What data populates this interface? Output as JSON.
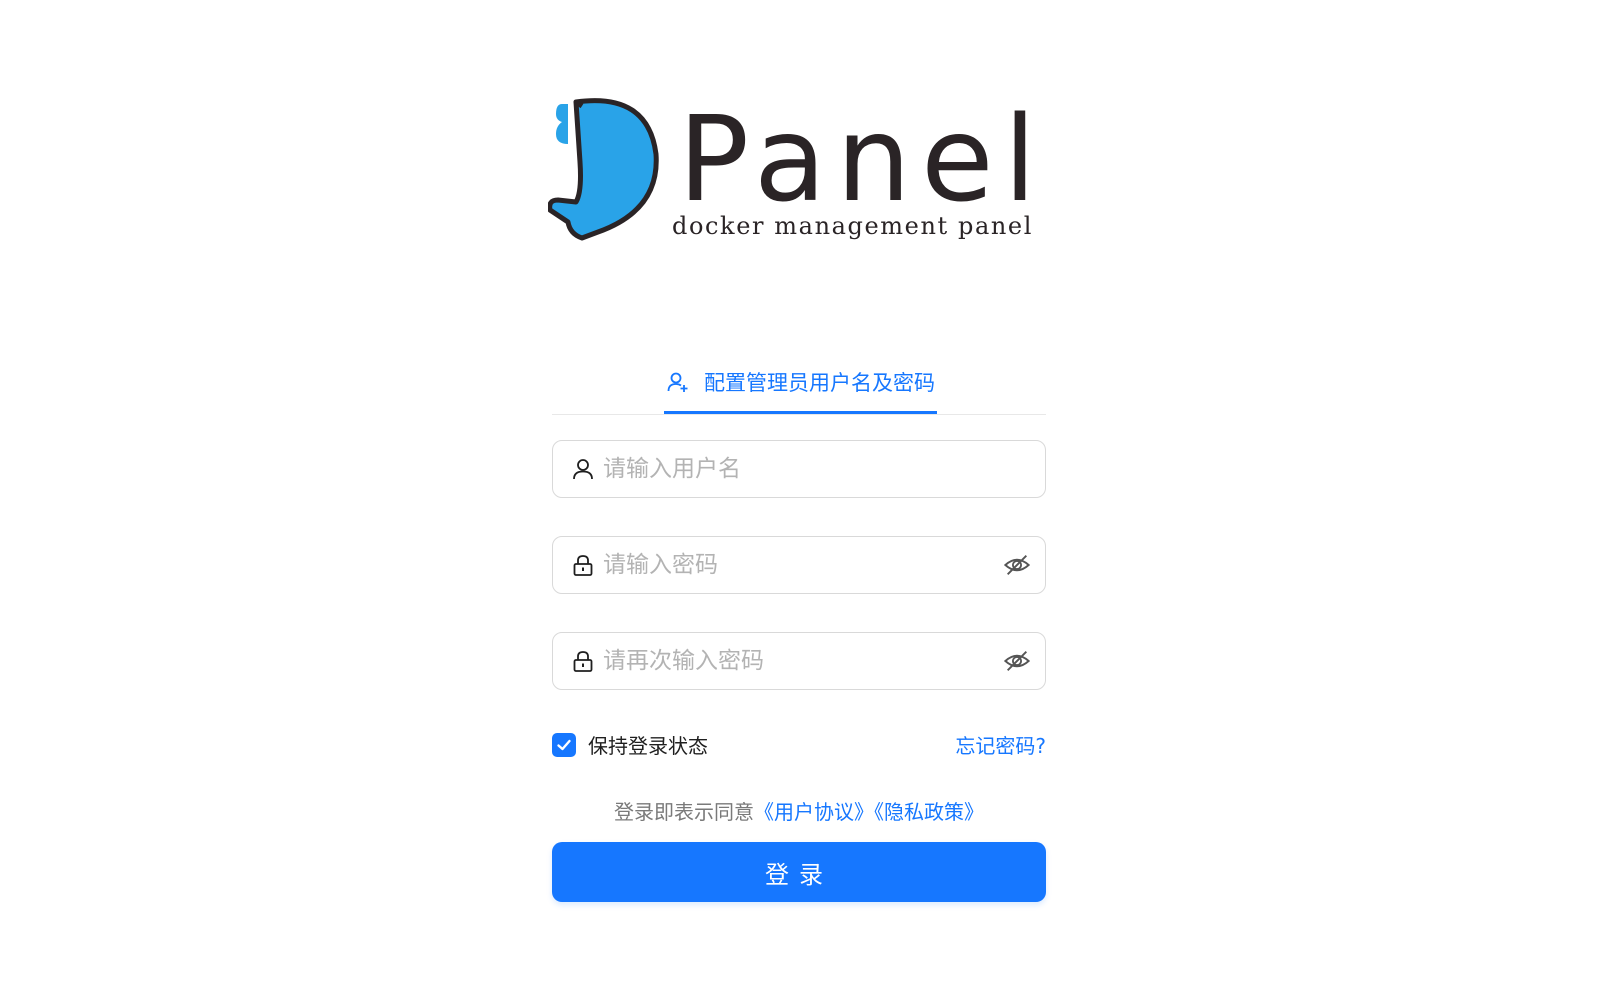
{
  "logo": {
    "title": "Panel",
    "subtitle": "docker management panel"
  },
  "tab": {
    "label": "配置管理员用户名及密码"
  },
  "username": {
    "placeholder": "请输入用户名"
  },
  "password": {
    "placeholder": "请输入密码"
  },
  "confirm": {
    "placeholder": "请再次输入密码"
  },
  "remember": {
    "label": "保持登录状态",
    "checked": true
  },
  "forgot": {
    "label": "忘记密码?"
  },
  "agreement": {
    "prefix": "登录即表示同意",
    "terms": "《用户协议》",
    "privacy": "《隐私政策》"
  },
  "submit": {
    "label": "登录"
  },
  "colors": {
    "accent": "#1677ff",
    "whale": "#29a3e8",
    "ink": "#2a2426"
  }
}
